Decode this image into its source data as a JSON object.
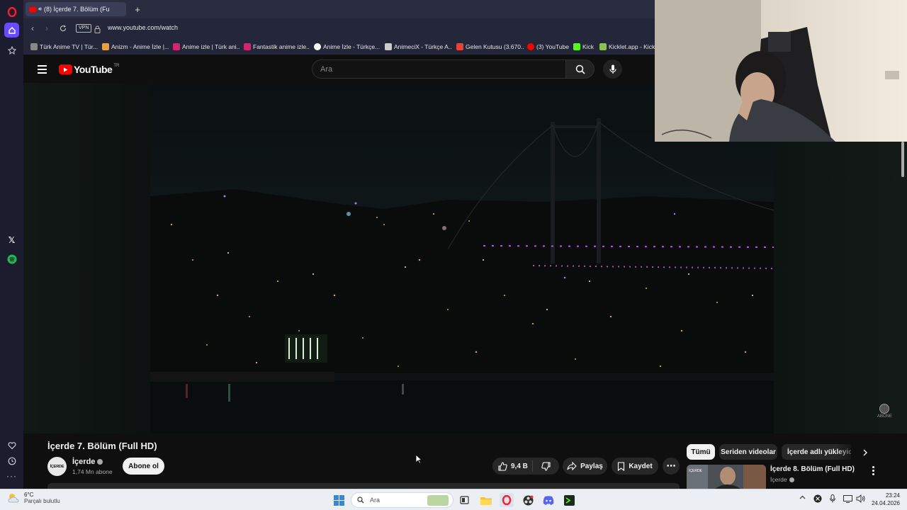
{
  "browser": {
    "tab_title": "(8) İçerde 7. Bölüm (Fu",
    "new_tab": "+",
    "vpn_label": "VPN",
    "url": "www.youtube.com/watch",
    "bookmarks": [
      {
        "label": "Türk Anime TV | Tür...",
        "color": "#888888"
      },
      {
        "label": "Anizm - Anime İzle |...",
        "color": "#e6a23c"
      },
      {
        "label": "Anime izle | Türk ani...",
        "color": "#d6246e"
      },
      {
        "label": "Fantastik anime izle...",
        "color": "#d6246e"
      },
      {
        "label": "Anime İzle - Türkçe...",
        "color": "#ffffff"
      },
      {
        "label": "AnimeciX - Türkçe A...",
        "color": "#cccccc"
      },
      {
        "label": "Gelen Kutusu (3.670...",
        "color": "#ea4335"
      },
      {
        "label": "(3) YouTube",
        "color": "#ff0000"
      },
      {
        "label": "Kick",
        "color": "#53fc18"
      },
      {
        "label": "Kicklet.app - Kick ...",
        "color": "#8bc34a"
      }
    ]
  },
  "youtube": {
    "logo_text": "YouTube",
    "region": "TR",
    "search_placeholder": "Ara",
    "video_title": "İçerde 7. Bölüm (Full HD)",
    "channel_name": "İçerde",
    "channel_logo_text": "İÇERDE",
    "subscribers": "1,74 Mn abone",
    "subscribe_label": "Abone ol",
    "like_count": "9,4 B",
    "share_label": "Paylaş",
    "save_label": "Kaydet",
    "more_label": "⋯",
    "watermark_label": "ABONE",
    "filter_chips": [
      "Tümü",
      "Seriden videolar",
      "İçerde adlı yükleyicide"
    ],
    "next_video": {
      "title": "İçerde 8. Bölüm (Full HD)",
      "channel": "İçerde"
    }
  },
  "taskbar": {
    "weather_temp": "6°C",
    "weather_desc": "Parçalı bulutlu",
    "search_placeholder": "Ara",
    "time": "23:24",
    "date": "24.04.2026"
  },
  "colors": {
    "yt_red": "#ff0000",
    "accent_opera": "#ff1b2d",
    "sidebar": "#1b1d2e"
  }
}
